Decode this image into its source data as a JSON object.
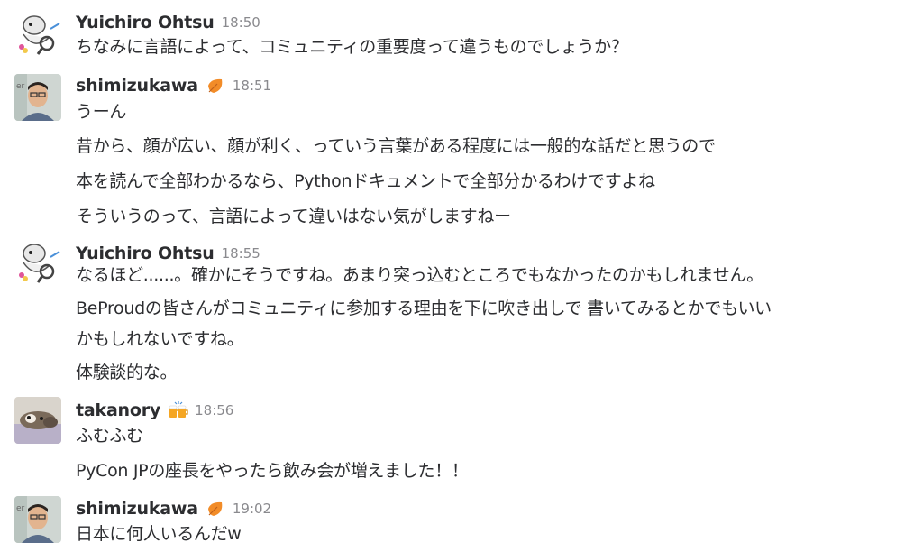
{
  "messages": [
    {
      "author": "Yuichiro Ohtsu",
      "time": "18:50",
      "lines": [
        "ちなみに言語によって、コミュニティの重要度って違うものでしょうか？"
      ]
    },
    {
      "author": "shimizukawa",
      "time": "18:51",
      "lines": [
        "うーん",
        "昔から、顔が広い、顔が利く、っていう言葉がある程度には一般的な話だと思うので",
        "本を読んで全部わかるなら、Pythonドキュメントで全部分かるわけですよね",
        "そういうのって、言語によって違いはない気がしますねー"
      ]
    },
    {
      "author": "Yuichiro Ohtsu",
      "time": "18:55",
      "lines": [
        "なるほど......。確かにそうですね。あまり突っ込むところでもなかったのかもしれません。",
        "BeProudの皆さんがコミュニティに参加する理由を下に吹き出しで 書いてみるとかでもいい",
        "かもしれないですね。",
        "体験談的な。"
      ]
    },
    {
      "author": "takanory",
      "time": "18:56",
      "lines": [
        "ふむふむ",
        "PyCon JPの座長をやったら飲み会が増えました！！"
      ]
    },
    {
      "author": "shimizukawa",
      "time": "19:02",
      "lines": [
        "日本に何人いるんだw"
      ]
    }
  ],
  "colors": {
    "text": "#2c2d30",
    "timestamp": "#8a8a8e",
    "badge_orange": "#f28c28"
  },
  "icons": {
    "shimizukawa_badge": "orange-leaf-emoji",
    "takanory_badge": "beer-mugs-emoji"
  }
}
